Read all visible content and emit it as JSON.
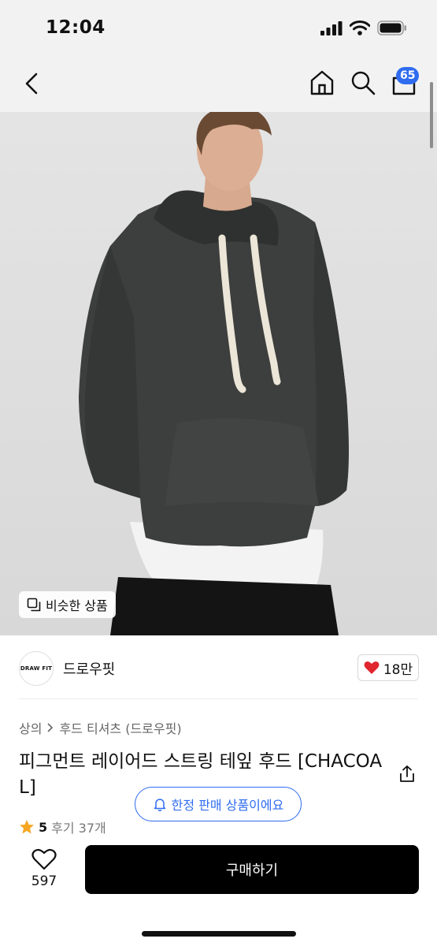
{
  "status_bar": {
    "time": "12:04"
  },
  "nav": {
    "cart_count": "65"
  },
  "product_image": {
    "similar_label": "비슷한 상품"
  },
  "brand": {
    "logo_text": "DRAW FIT",
    "name": "드로우핏",
    "likes": "18만"
  },
  "breadcrumb": {
    "category": "상의",
    "subcategory": "후드 티셔츠 (드로우핏)"
  },
  "product": {
    "title": "피그먼트 레이어드 스트링 테잎 후드 [CHACOAL]",
    "limited_label": "한정 판매 상품이에요",
    "rating": "5",
    "reviews": "후기 37개"
  },
  "bottom_bar": {
    "wish_count": "597",
    "buy_label": "구매하기"
  },
  "colors": {
    "accent": "#2f6cf0",
    "like_red": "#e0262f",
    "star": "#f5a623",
    "buy_bg": "#000000"
  },
  "icons": [
    "back-icon",
    "home-icon",
    "search-icon",
    "cart-icon",
    "similar-icon",
    "heart-icon",
    "chevron-right-icon",
    "share-icon",
    "bell-icon",
    "star-icon",
    "heart-outline-icon"
  ]
}
